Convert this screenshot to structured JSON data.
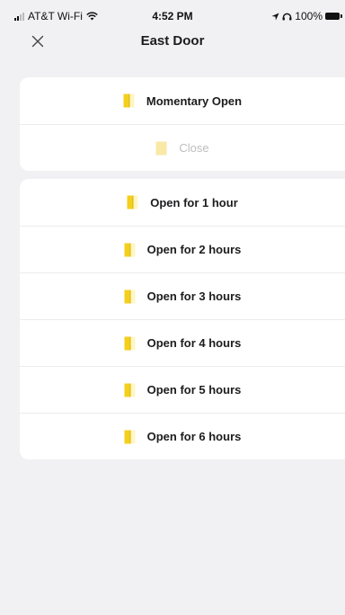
{
  "status_bar": {
    "carrier": "AT&T Wi-Fi",
    "time": "4:52 PM",
    "battery": "100%"
  },
  "nav": {
    "title": "East Door",
    "close_icon": "close-icon"
  },
  "colors": {
    "door_icon": "#f5cf1d",
    "door_icon_disabled": "#f8e9a6",
    "background": "#f1f1f3",
    "card": "#ffffff"
  },
  "actions_primary": [
    {
      "label": "Momentary Open",
      "icon": "door-icon",
      "enabled": true
    },
    {
      "label": "Close",
      "icon": "door-icon",
      "enabled": false
    }
  ],
  "actions_hold_open": [
    {
      "label": "Open for 1 hour",
      "icon": "door-icon",
      "enabled": true
    },
    {
      "label": "Open for 2 hours",
      "icon": "door-icon",
      "enabled": true
    },
    {
      "label": "Open for 3 hours",
      "icon": "door-icon",
      "enabled": true
    },
    {
      "label": "Open for 4 hours",
      "icon": "door-icon",
      "enabled": true
    },
    {
      "label": "Open for 5 hours",
      "icon": "door-icon",
      "enabled": true
    },
    {
      "label": "Open for 6 hours",
      "icon": "door-icon",
      "enabled": true
    }
  ]
}
